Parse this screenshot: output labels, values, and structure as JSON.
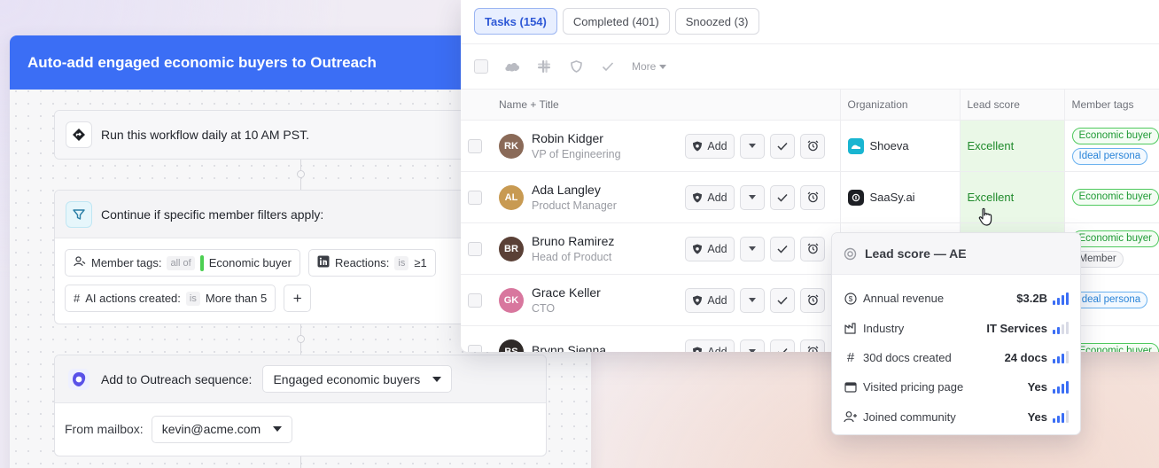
{
  "workflow": {
    "title": "Auto-add engaged economic buyers to Outreach",
    "schedule_text": "Run this workflow daily at 10 AM PST.",
    "filter_text": "Continue if specific member filters apply:",
    "filters": {
      "member_tags": {
        "label": "Member tags:",
        "op": "all of",
        "value": "Economic buyer"
      },
      "reactions": {
        "label": "Reactions:",
        "op": "is",
        "value": "≥1"
      },
      "ai_actions": {
        "label": "AI actions created:",
        "op": "is",
        "value": "More than 5"
      },
      "add_label": "+"
    },
    "outreach": {
      "label": "Add to Outreach sequence:",
      "sequence": "Engaged economic buyers",
      "mailbox_label": "From mailbox:",
      "mailbox": "kevin@acme.com"
    }
  },
  "tasks": {
    "tabs": [
      {
        "label": "Tasks (154)",
        "active": true
      },
      {
        "label": "Completed (401)",
        "active": false
      },
      {
        "label": "Snoozed (3)",
        "active": false
      }
    ],
    "toolbar_more": "More",
    "columns": {
      "name": "Name + Title",
      "organization": "Organization",
      "lead_score": "Lead score",
      "member_tags": "Member tags"
    },
    "add_label": "Add",
    "rows": [
      {
        "name": "Robin Kidger",
        "title": "VP of Engineering",
        "org": "Shoeva",
        "score": "Excellent",
        "tags": [
          "Economic buyer",
          "Ideal persona"
        ]
      },
      {
        "name": "Ada Langley",
        "title": "Product Manager",
        "org": "SaaSy.ai",
        "score": "Excellent",
        "tags": [
          "Economic buyer"
        ]
      },
      {
        "name": "Bruno Ramirez",
        "title": "Head of Product",
        "org": "",
        "score": "",
        "tags": [
          "Economic buyer",
          "Member"
        ]
      },
      {
        "name": "Grace Keller",
        "title": "CTO",
        "org": "",
        "score": "",
        "tags": [
          "Ideal persona"
        ]
      },
      {
        "name": "Brynn Sienna",
        "title": "",
        "org": "",
        "score": "",
        "tags": [
          "Economic buyer"
        ]
      }
    ]
  },
  "lead_popover": {
    "title": "Lead score — AE",
    "rows": [
      {
        "icon": "dollar-icon",
        "label": "Annual revenue",
        "value": "$3.2B",
        "level": 4
      },
      {
        "icon": "industry-icon",
        "label": "Industry",
        "value": "IT Services",
        "level": 2
      },
      {
        "icon": "hash-icon",
        "label": "30d docs created",
        "value": "24 docs",
        "level": 3
      },
      {
        "icon": "browser-icon",
        "label": "Visited pricing page",
        "value": "Yes",
        "level": 4
      },
      {
        "icon": "user-plus-icon",
        "label": "Joined community",
        "value": "Yes",
        "level": 3
      }
    ]
  },
  "colors": {
    "accent": "#3b6ef5",
    "score_green": "#1f8a2b",
    "tag_green": "#4fc95e",
    "tag_blue": "#6ab1ef"
  }
}
